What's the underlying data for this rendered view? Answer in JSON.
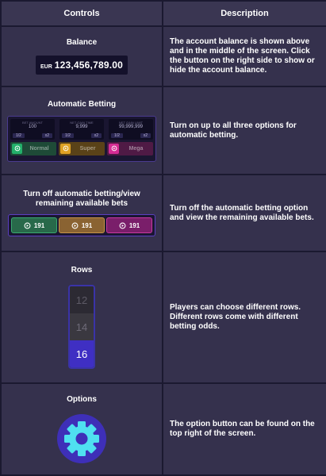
{
  "header": {
    "controls": "Controls",
    "description": "Description"
  },
  "rows": [
    {
      "title": "Balance",
      "desc": "The account balance is shown above and in the middle of the screen. Click the button on the right side to show or hide the account balance."
    },
    {
      "title": "Automatic Betting",
      "desc": "Turn on up to all three options for automatic betting."
    },
    {
      "title": "Turn off automatic betting/view remaining available bets",
      "desc": "Turn off the automatic betting option and view the remaining available bets."
    },
    {
      "title": "Rows",
      "desc": "Players can choose different rows. Different rows come with different betting odds."
    },
    {
      "title": "Options",
      "desc": "The option button can be found on the top right of the screen."
    }
  ],
  "balance": {
    "currency": "EUR",
    "amount": "123,456,789.00"
  },
  "auto_betting": {
    "fields": [
      {
        "label": "BET AMOUNT",
        "value": "100",
        "minus": "1/2",
        "plus": "x2"
      },
      {
        "label": "NET GAIN TIME",
        "value": "9,999",
        "minus": "1/2",
        "plus": "x2"
      },
      {
        "label": "NET GAIN LIMIT",
        "value": "99,999,999",
        "minus": "1/2",
        "plus": "x2"
      }
    ],
    "modes": [
      "Normal",
      "Super",
      "Mega"
    ]
  },
  "remaining": {
    "normal": "191",
    "super": "191",
    "mega": "191"
  },
  "row_options": [
    "12",
    "14",
    "16"
  ],
  "colors": {
    "normal": "#23b06a",
    "super": "#e0a224",
    "mega": "#d42c94",
    "row_selected": "#3f2fc3",
    "gear": "#4fe0f0",
    "gear_ring": "#3e2fb8"
  },
  "icons": {
    "options": "gear-icon",
    "auto": "autoplay-icon"
  }
}
